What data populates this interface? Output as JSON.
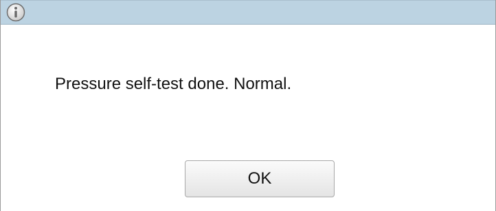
{
  "dialog": {
    "title_icon": "info-icon",
    "message": "Pressure self-test done. Normal.",
    "ok_label": "OK"
  },
  "colors": {
    "titlebar": "#bcd3e2",
    "background": "#ffffff",
    "text": "#111111"
  }
}
